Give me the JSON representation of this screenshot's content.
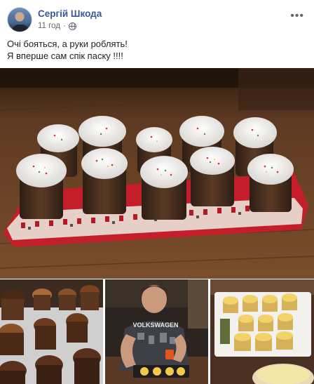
{
  "post": {
    "author": "Сергій Шкода",
    "time": "11 год",
    "separator": "·",
    "privacy_icon": "globe-icon",
    "more_icon": "more-options-icon",
    "text_lines": [
      "Очі бояться, а руки роблять!",
      "Я вперше сам спік паску !!!!"
    ]
  },
  "photos": {
    "main": "easter-breads-on-embroidered-towel",
    "thumbnails": [
      "baked-breads-on-tray",
      "man-in-volkswagen-shirt-pouring-dough",
      "dough-in-paper-molds"
    ],
    "shirt_text": "VOLKSWAGEN"
  },
  "colors": {
    "link": "#385898",
    "text": "#1c1e21",
    "meta": "#616770",
    "towel_red": "#c41e2a"
  }
}
